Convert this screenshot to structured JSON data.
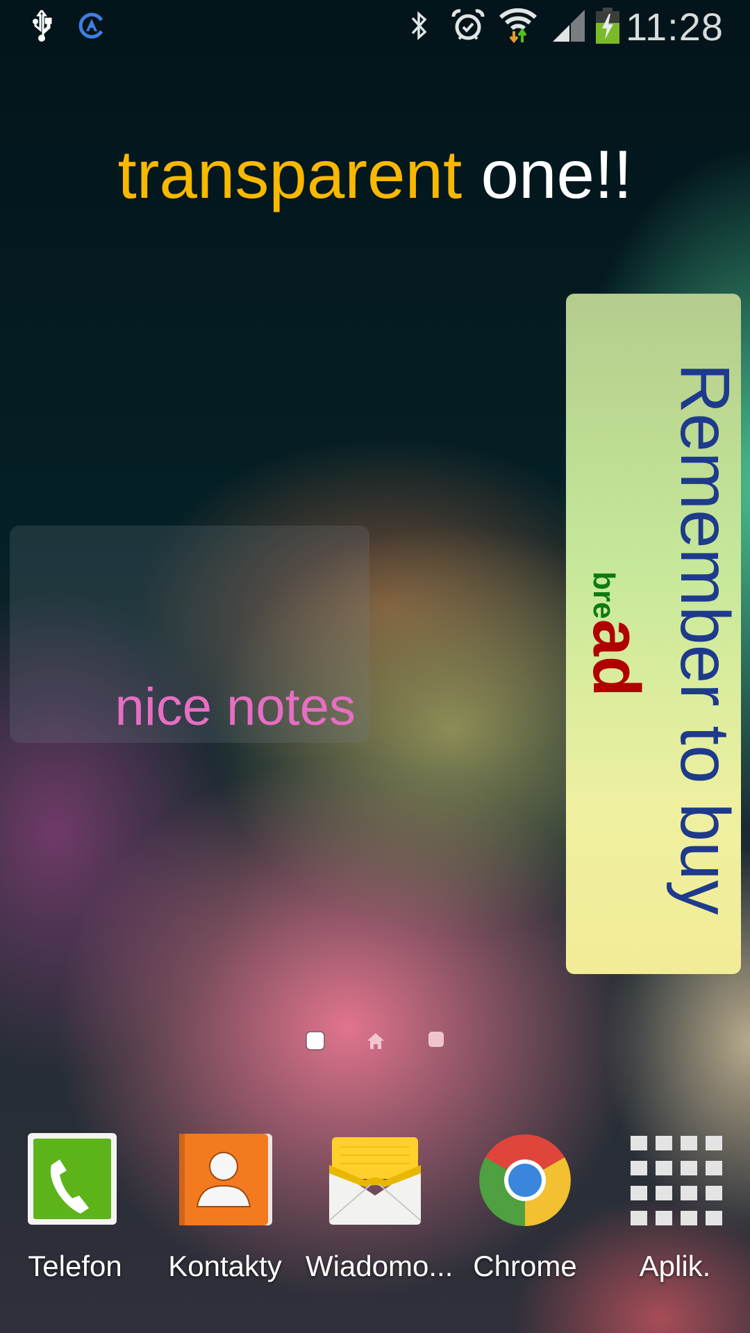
{
  "status_bar": {
    "left_icons": [
      "usb-icon",
      "airdroid-icon"
    ],
    "right_icons": [
      "bluetooth-icon",
      "alarm-icon",
      "wifi-data-icon",
      "signal-icon",
      "battery-charging-icon"
    ],
    "time": "11:28"
  },
  "headline_widget": {
    "word1": "transparent",
    "word2": "one!!",
    "colors": {
      "word1": "#f9b800",
      "word2": "#ffffff"
    }
  },
  "note_widget": {
    "text": "nice notes",
    "color": "#e66ec3"
  },
  "reminder_widget": {
    "main_text": "Remember to buy",
    "item_part1": "bre",
    "item_part2": "ad",
    "colors": {
      "main": "#1e3a8c",
      "part1": "#0e7a10",
      "part2": "#b00000"
    }
  },
  "page_indicator": {
    "pages": [
      "page-1",
      "home",
      "page-3"
    ],
    "current_index": 0
  },
  "dock": {
    "apps": [
      {
        "label": "Telefon",
        "icon": "phone-icon"
      },
      {
        "label": "Kontakty",
        "icon": "contacts-icon"
      },
      {
        "label": "Wiadomo...",
        "icon": "messages-icon"
      },
      {
        "label": "Chrome",
        "icon": "chrome-icon"
      },
      {
        "label": "Aplik.",
        "icon": "apps-grid-icon"
      }
    ]
  }
}
